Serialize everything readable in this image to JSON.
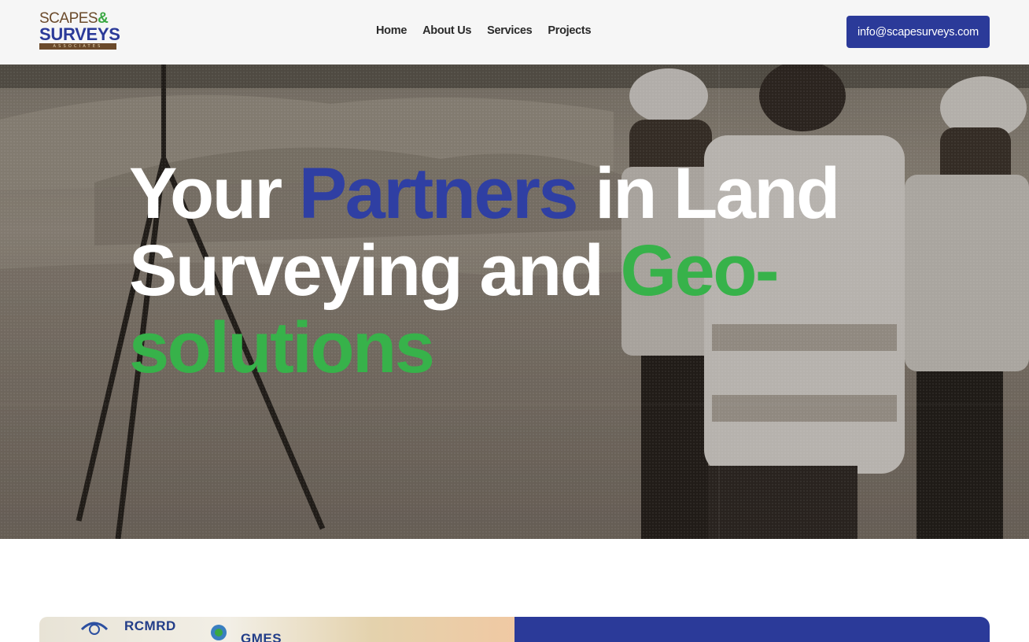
{
  "brand": {
    "line1": "SCAPES",
    "amp": "&",
    "line2": "SURVEYS",
    "line3": "ASSOCIATES"
  },
  "nav": {
    "items": [
      "Home",
      "About Us",
      "Services",
      "Projects"
    ]
  },
  "header": {
    "email_label": "info@scapesurveys.com"
  },
  "hero": {
    "headline": {
      "part1": "Your ",
      "part2": "Partners",
      "part3": " in Land Surveying and ",
      "part4": "Geo-solutions"
    }
  },
  "lower": {
    "badge1": "RCMRD",
    "badge2": "GMES"
  },
  "colors": {
    "brand_blue": "#2b3a99",
    "brand_green": "#37b24a",
    "brand_brown": "#6b4a2b"
  }
}
